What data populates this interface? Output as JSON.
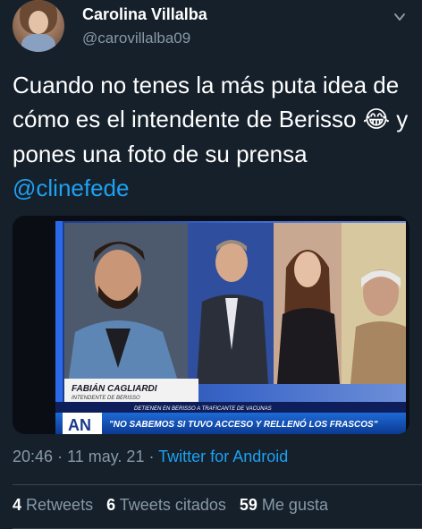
{
  "author": {
    "name": "Carolina Villalba",
    "handle": "@carovillalba09"
  },
  "tweet": {
    "text_1": "Cuando no tenes la más puta idea de cómo es el intendente de Berisso ",
    "emoji": "😂",
    "text_2": " y pones una foto de su prensa ",
    "mention": "@clinefede"
  },
  "media": {
    "lower_third_name": "FABIÁN CAGLIARDI",
    "lower_third_role": "INTENDENTE DE BERISSO",
    "ticker_small": "DETIENEN EN BERISSO A TRAFICANTE DE VACUNAS",
    "ticker_big": "\"NO SABEMOS SI TUVO ACCESO Y RELLENÓ LOS FRASCOS\"",
    "channel_logo": "AN"
  },
  "meta": {
    "time": "20:46",
    "date": "11 may. 21",
    "separator": "·",
    "source": "Twitter for Android"
  },
  "stats": {
    "retweets_count": "4",
    "retweets_label": "Retweets",
    "quotes_count": "6",
    "quotes_label": "Tweets citados",
    "likes_count": "59",
    "likes_label": "Me gusta"
  },
  "colors": {
    "background": "#15202b",
    "link": "#1da1f2",
    "secondary_text": "#8899a6",
    "divider": "#38444d"
  }
}
